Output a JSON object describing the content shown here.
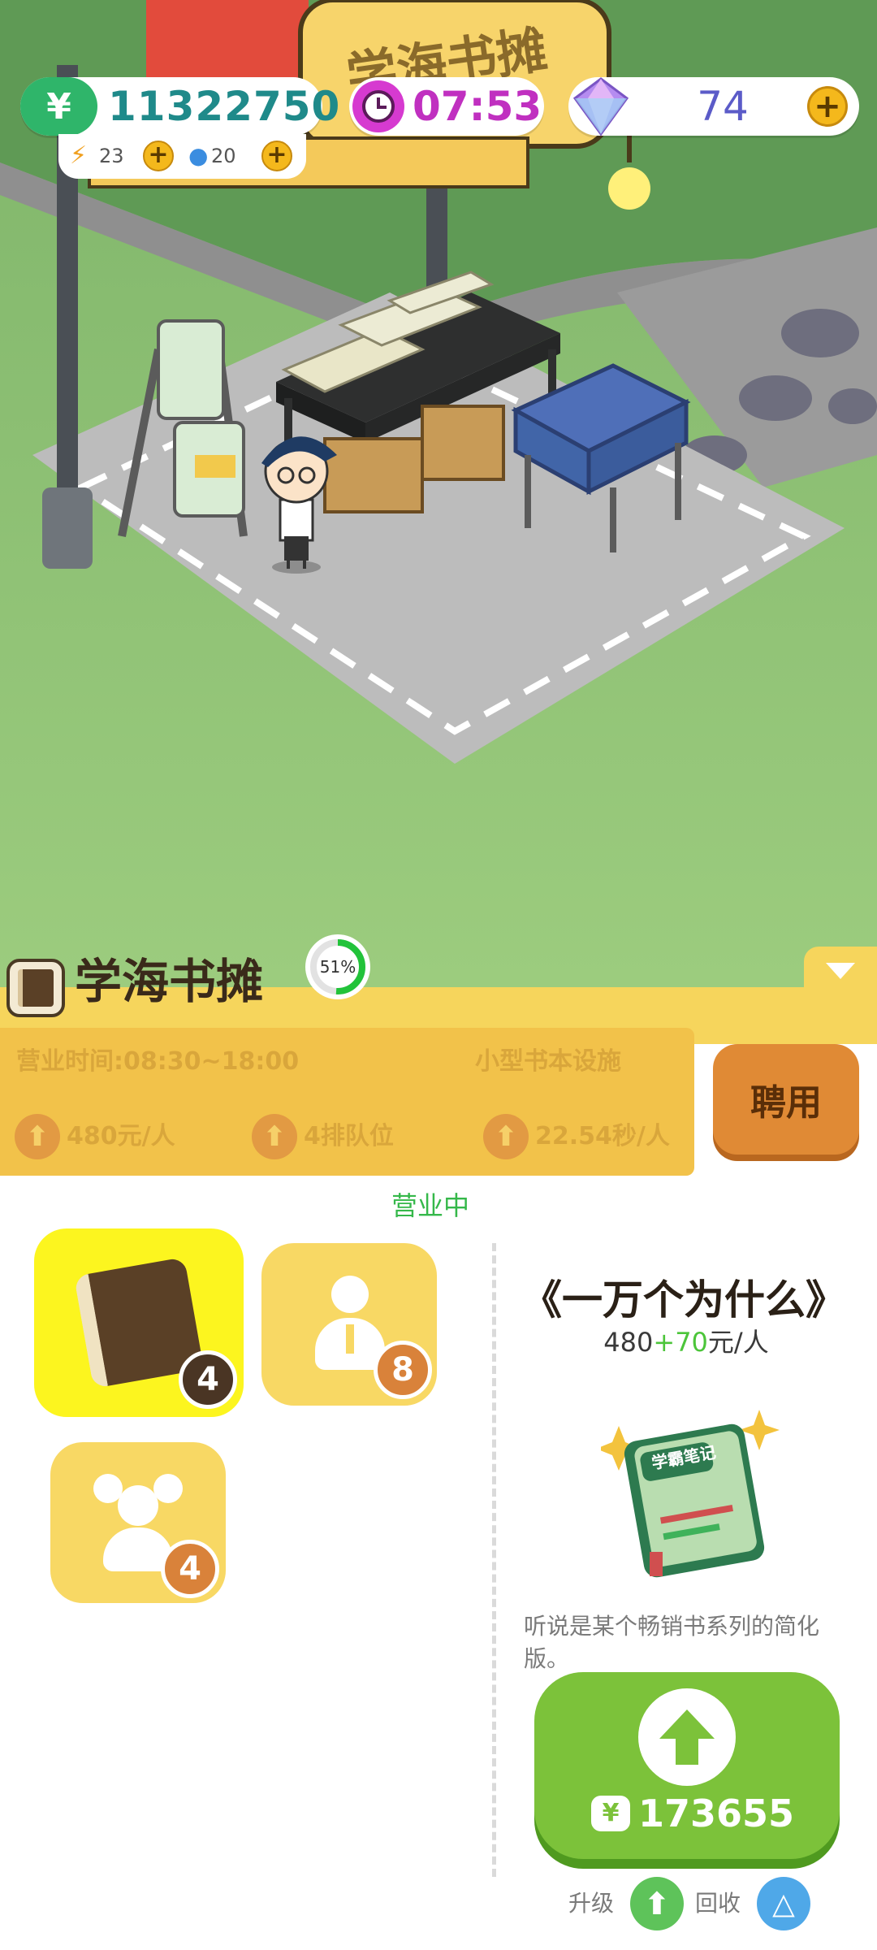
{
  "hud": {
    "money": "11322750",
    "money_icon": "yuan-icon",
    "time": "07:53",
    "gems": "74",
    "energy": "23",
    "water": "20"
  },
  "scene": {
    "sign_text": "学海书摊"
  },
  "shop": {
    "name": "学海书摊",
    "progress_label": "51%",
    "progress_value": 0.51,
    "hours": "营业时间:08:30~18:00",
    "facility": "小型书本设施",
    "price_stat": "480元/人",
    "queue_stat": "4排队位",
    "speed_stat": "22.54秒/人",
    "hire_label": "聘用",
    "status": "营业中"
  },
  "tabs": [
    {
      "icon": "book-icon",
      "count": "4"
    },
    {
      "icon": "staff-icon",
      "count": "8"
    },
    {
      "icon": "customer-icon",
      "count": "4"
    }
  ],
  "item": {
    "title": "《一万个为什么》",
    "price_base": "480",
    "price_bonus": "+70",
    "price_unit": "元/人",
    "book_cover_text": "学霸笔记",
    "description": "听说是某个畅销书系列的简化版。",
    "upgrade_cost": "173655",
    "upgrade_label": "升级",
    "recycle_label": "回收"
  },
  "colors": {
    "panel_yellow": "#f6d55c",
    "accent_orange": "#e08a35",
    "green_button": "#7cc23a",
    "status_green": "#35b84a",
    "bonus_green": "#4cc53a"
  }
}
